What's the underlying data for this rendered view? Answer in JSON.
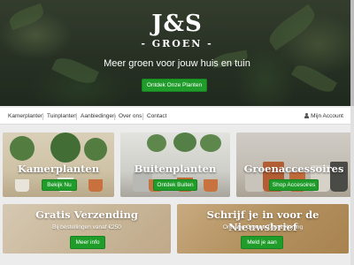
{
  "hero": {
    "logo_main": "J&S",
    "logo_sub": "- GROEN -",
    "tagline": "Meer groen voor jouw huis en tuin",
    "cta_label": "Ontdek Onze Planten"
  },
  "nav": {
    "items": [
      "Kamerplanten",
      "Tuinplanten",
      "Aanbiedingen",
      "Over ons",
      "Contact"
    ],
    "account_label": "Mijn Account"
  },
  "categories": [
    {
      "title": "Kamerplanten",
      "button": "Bekijk Nu"
    },
    {
      "title": "Buitenplanten",
      "button": "Ontdek Buiten"
    },
    {
      "title": "Groenaccessoires",
      "button": "Shop Accesoires"
    }
  ],
  "promos": [
    {
      "title": "Gratis Verzending",
      "subtitle": "Bij bestellingen vanaf €250",
      "button": "Meer info"
    },
    {
      "title": "Schrijf je in voor de Nieuwsbrief",
      "subtitle": "Ontvang Groene Tips & Korting",
      "button": "Meld je aan"
    }
  ],
  "colors": {
    "accent_green": "#1f9c2a",
    "nav_background": "#ffffff",
    "page_background": "#ececec"
  },
  "icons": {
    "account": "person-icon"
  }
}
